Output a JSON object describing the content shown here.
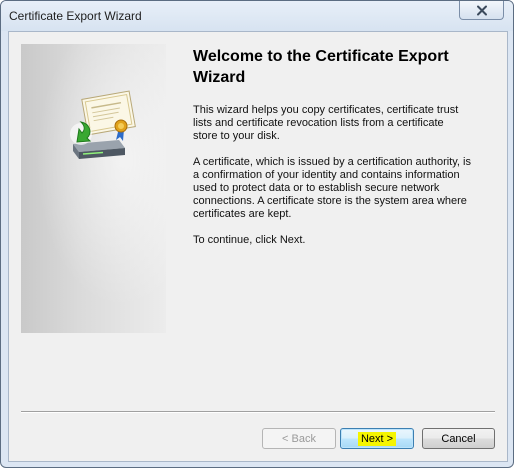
{
  "window": {
    "title": "Certificate Export Wizard"
  },
  "icons": {
    "close": "close-icon",
    "wizard": "certificate-export-icon"
  },
  "main": {
    "heading": "Welcome to the Certificate Export\nWizard",
    "paragraphs": [
      "This wizard helps you copy certificates, certificate trust\nlists and certificate revocation lists from a certificate\nstore to your disk.",
      "A certificate, which is issued by a certification authority, is\na confirmation of your identity and contains information\nused to protect data or to establish secure network\nconnections. A certificate store is the system area where\ncertificates are kept.",
      "To continue, click Next."
    ]
  },
  "buttons": {
    "back": "< Back",
    "next": "Next >",
    "cancel": "Cancel"
  },
  "colors": {
    "highlight": "#f5f500",
    "next_button_border": "#3c7fb1"
  }
}
